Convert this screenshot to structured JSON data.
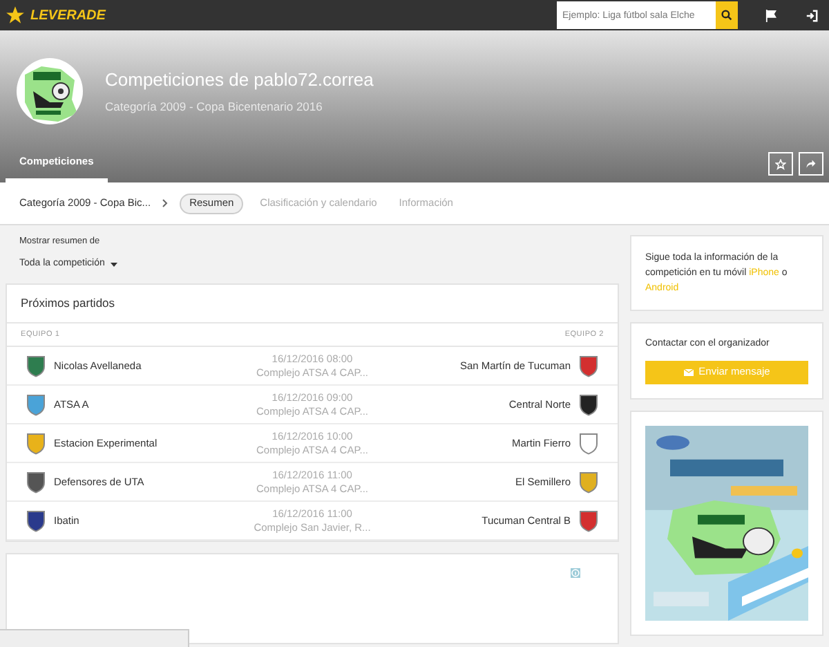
{
  "topbar": {
    "brand": "LEVERADE",
    "search": {
      "placeholder": "Ejemplo: Liga fútbol sala Elche"
    }
  },
  "header": {
    "title": "Competiciones de pablo72.correa",
    "subtitle": "Categoría 2009 - Copa Bicentenario 2016",
    "tabs": [
      {
        "label": "Competiciones",
        "selected": true
      }
    ]
  },
  "subnav": {
    "breadcrumb": "Categoría 2009 - Copa Bic...",
    "tabs": [
      {
        "label": "Resumen",
        "selected": true
      },
      {
        "label": "Clasificación y calendario",
        "selected": false
      },
      {
        "label": "Información",
        "selected": false
      }
    ]
  },
  "filter": {
    "label": "Mostrar resumen de",
    "value": "Toda la competición"
  },
  "matches": {
    "title": "Próximos partidos",
    "columns": [
      "EQUIPO 1",
      "EQUIPO 2"
    ],
    "rows": [
      {
        "home": {
          "name": "Nicolas Avellaneda",
          "color": "#2e7d4f"
        },
        "date": "16/12/2016 08:00",
        "venue": "Complejo ATSA 4 CAP...",
        "away": {
          "name": "San Martín de Tucuman",
          "color": "#d32f2f"
        }
      },
      {
        "home": {
          "name": "ATSA A",
          "color": "#4aa3d8"
        },
        "date": "16/12/2016 09:00",
        "venue": "Complejo ATSA 4 CAP...",
        "away": {
          "name": "Central Norte",
          "color": "#222222"
        }
      },
      {
        "home": {
          "name": "Estacion Experimental",
          "color": "#e8b21a"
        },
        "date": "16/12/2016 10:00",
        "venue": "Complejo ATSA 4 CAP...",
        "away": {
          "name": "Martin Fierro",
          "color": "#ffffff"
        }
      },
      {
        "home": {
          "name": "Defensores de UTA",
          "color": "#555555"
        },
        "date": "16/12/2016 11:00",
        "venue": "Complejo ATSA 4 CAP...",
        "away": {
          "name": "El Semillero",
          "color": "#e0b020"
        }
      },
      {
        "home": {
          "name": "Ibatin",
          "color": "#2a3a8c"
        },
        "date": "16/12/2016 11:00",
        "venue": "Complejo San Javier, R...",
        "away": {
          "name": "Tucuman Central B",
          "color": "#d32f2f"
        }
      }
    ]
  },
  "sidebar": {
    "app_parts": [
      "Sigue toda la información de la competición en tu móvil ",
      "iPhone",
      " o ",
      "Android"
    ],
    "contact_label": "Contactar con el organizador",
    "contact_button": "Enviar mensaje"
  }
}
